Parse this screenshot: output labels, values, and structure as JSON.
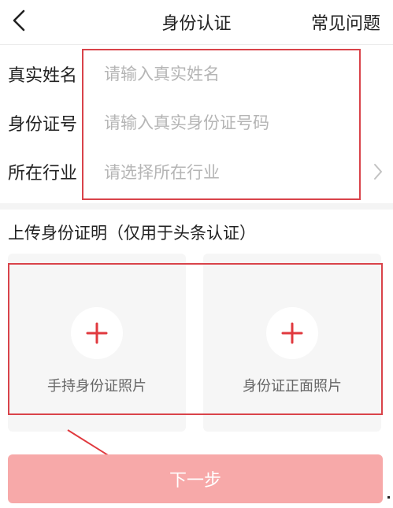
{
  "header": {
    "title": "身份认证",
    "faq_label": "常见问题"
  },
  "form": {
    "name": {
      "label": "真实姓名",
      "placeholder": "请输入真实姓名",
      "value": ""
    },
    "id_number": {
      "label": "身份证号",
      "placeholder": "请输入真实身份证号码",
      "value": ""
    },
    "industry": {
      "label": "所在行业",
      "placeholder": "请选择所在行业"
    }
  },
  "upload": {
    "title": "上传身份证明（仅用于头条认证）",
    "cards": [
      {
        "label": "手持身份证照片"
      },
      {
        "label": "身份证正面照片"
      }
    ]
  },
  "next_button": {
    "label": "下一步"
  },
  "colors": {
    "accent": "#e0393e",
    "button_bg": "#f7a9a9",
    "annotation": "#d9434a",
    "placeholder": "#b5b5b5"
  },
  "icons": {
    "back": "chevron-left-icon",
    "industry_arrow": "chevron-right-icon",
    "upload": "plus-icon"
  }
}
